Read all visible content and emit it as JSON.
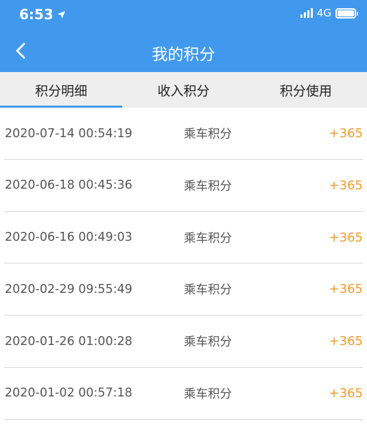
{
  "status_bar": {
    "time": "6:53",
    "network": "4G"
  },
  "nav": {
    "title": "我的积分",
    "back_icon": "chevron-left-icon"
  },
  "tabs": [
    {
      "label": "积分明细",
      "active": true
    },
    {
      "label": "收入积分",
      "active": false
    },
    {
      "label": "积分使用",
      "active": false
    }
  ],
  "records": [
    {
      "datetime": "2020-07-14 00:54:19",
      "type": "乘车积分",
      "points": "+365"
    },
    {
      "datetime": "2020-06-18 00:45:36",
      "type": "乘车积分",
      "points": "+365"
    },
    {
      "datetime": "2020-06-16 00:49:03",
      "type": "乘车积分",
      "points": "+365"
    },
    {
      "datetime": "2020-02-29 09:55:49",
      "type": "乘车积分",
      "points": "+365"
    },
    {
      "datetime": "2020-01-26 01:00:28",
      "type": "乘车积分",
      "points": "+365"
    },
    {
      "datetime": "2020-01-02 00:57:18",
      "type": "乘车积分",
      "points": "+365"
    }
  ],
  "colors": {
    "header": "#4199ee",
    "points": "#f39a2a",
    "tab_bar": "#eeeeee"
  }
}
